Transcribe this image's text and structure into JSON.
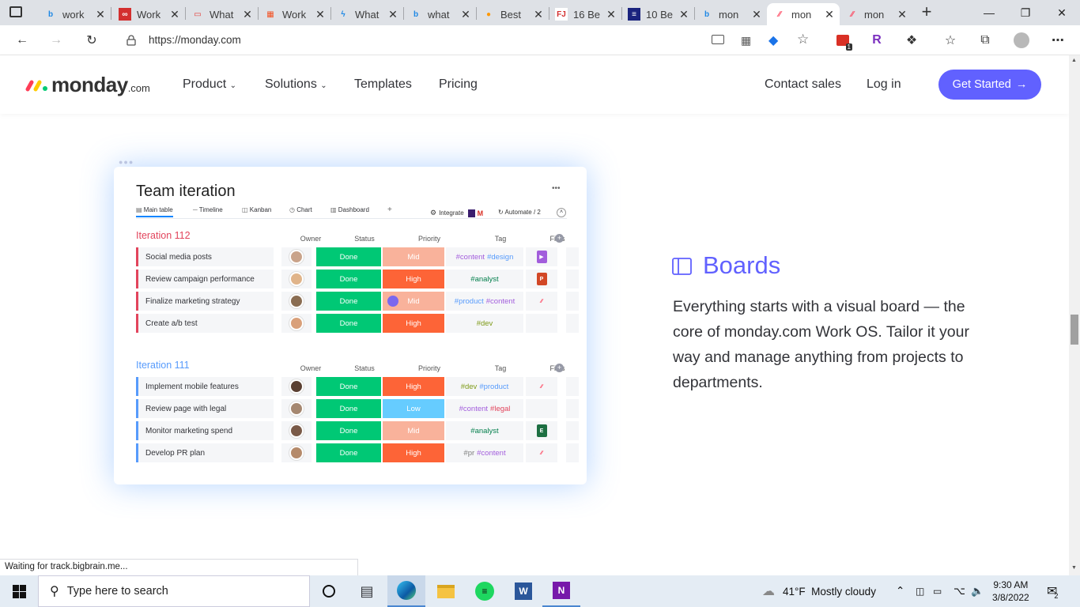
{
  "browser": {
    "tabs": [
      {
        "title": "work",
        "icon": "bing-icon"
      },
      {
        "title": "Work",
        "icon": "red-logo-icon"
      },
      {
        "title": "What",
        "icon": "oracle-icon"
      },
      {
        "title": "Work",
        "icon": "microsoft-icon"
      },
      {
        "title": "What",
        "icon": "blue-bolt-icon"
      },
      {
        "title": "what",
        "icon": "bing-icon"
      },
      {
        "title": "Best",
        "icon": "colorful-circle-icon"
      },
      {
        "title": "16 Be",
        "icon": "fj-icon"
      },
      {
        "title": "10 Be",
        "icon": "dark-site-icon"
      },
      {
        "title": "mon",
        "icon": "bing-icon"
      },
      {
        "title": "mon",
        "icon": "monday-icon"
      },
      {
        "title": "mon",
        "icon": "monday-icon"
      }
    ],
    "url": "https://monday.com",
    "extension_badge": "1",
    "status_text": "Waiting for track.bigbrain.me..."
  },
  "site": {
    "logo_word": "monday",
    "logo_suffix": ".com",
    "nav": {
      "product": "Product",
      "solutions": "Solutions",
      "templates": "Templates",
      "pricing": "Pricing"
    },
    "contact_sales": "Contact sales",
    "login": "Log in",
    "get_started": "Get Started"
  },
  "board": {
    "title": "Team iteration",
    "more": "•••",
    "views": [
      "Main table",
      "Timeline",
      "Kanban",
      "Chart",
      "Dashboard"
    ],
    "add_view": "+",
    "integrate": "Integrate",
    "automate": "Automate / 2",
    "columns": [
      "Owner",
      "Status",
      "Priority",
      "Tag",
      "Files"
    ],
    "colors": {
      "done": "#00c875",
      "high": "#fd6437",
      "mid": "#f9b29b",
      "low": "#66ccff",
      "group1": "#e2445c",
      "group2": "#579bfc"
    },
    "groups": [
      {
        "title": "Iteration 112",
        "rows": [
          {
            "item": "Social media posts",
            "status": "Done",
            "priority": "Mid",
            "tags": [
              "#content",
              "#design"
            ],
            "file": "purple-doc"
          },
          {
            "item": "Review campaign performance",
            "status": "Done",
            "priority": "High",
            "tags": [
              "#analyst"
            ],
            "file": "ppt"
          },
          {
            "item": "Finalize marketing strategy",
            "status": "Done",
            "priority": "Mid",
            "tags": [
              "#product",
              "#content"
            ],
            "file": "monday"
          },
          {
            "item": "Create a/b test",
            "status": "Done",
            "priority": "High",
            "tags": [
              "#dev"
            ],
            "file": ""
          }
        ]
      },
      {
        "title": "Iteration 111",
        "rows": [
          {
            "item": "Implement mobile features",
            "status": "Done",
            "priority": "High",
            "tags": [
              "#dev",
              "#product"
            ],
            "file": "monday"
          },
          {
            "item": "Review page with legal",
            "status": "Done",
            "priority": "Low",
            "tags": [
              "#content",
              "#legal"
            ],
            "file": ""
          },
          {
            "item": "Monitor marketing spend",
            "status": "Done",
            "priority": "Mid",
            "tags": [
              "#analyst"
            ],
            "file": "excel"
          },
          {
            "item": "Develop PR plan",
            "status": "Done",
            "priority": "High",
            "tags": [
              "#pr",
              "#content"
            ],
            "file": "monday"
          }
        ]
      }
    ]
  },
  "feature": {
    "title": "Boards",
    "description": "Everything starts with a visual board — the core of monday.com Work OS. Tailor it your way and manage anything from projects to departments."
  },
  "taskbar": {
    "search_placeholder": "Type here to search",
    "weather": "41°F  Mostly cloudy",
    "time": "9:30 AM",
    "date": "3/8/2022",
    "notification_count": "2"
  }
}
